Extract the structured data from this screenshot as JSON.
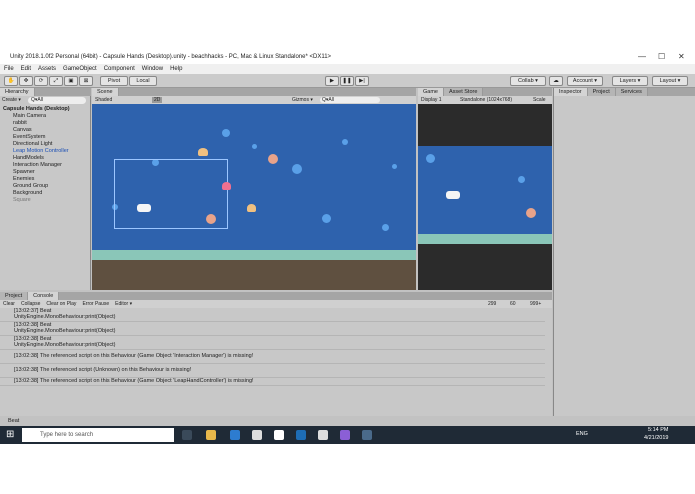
{
  "window": {
    "title": "Unity 2018.1.0f2 Personal (64bit) - Capsule Hands (Desktop).unity - beachhacks - PC, Mac & Linux Standalone* <DX11>"
  },
  "menu": [
    "File",
    "Edit",
    "Assets",
    "GameObject",
    "Component",
    "Window",
    "Help"
  ],
  "toolbar": {
    "pivot": "Pivot",
    "local": "Local",
    "collab": "Collab ▾",
    "account": "Account ▾",
    "layers": "Layers ▾",
    "layout": "Layout ▾"
  },
  "hierarchy": {
    "tab": "Hierarchy",
    "create": "Create ▾",
    "search": "Q▾All",
    "root": "Capsule Hands (Desktop)",
    "items": [
      "Main Camera",
      "rabbit",
      "Canvas",
      "EventSystem",
      "Directional Light",
      "Leap Motion Controller",
      "HandModels",
      "Interaction Manager",
      "Spawner",
      "Enemies",
      "Ground Group",
      "Background",
      "Square"
    ]
  },
  "scene": {
    "tab": "Scene",
    "shading": "Shaded",
    "mode": "2D",
    "gizmos": "Gizmos ▾",
    "search": "Q▾All"
  },
  "game": {
    "tab": "Game",
    "asset_store": "Asset Store",
    "display": "Display 1",
    "resolution": "Standalone (1024x768)",
    "scale": "Scale"
  },
  "inspector": {
    "tabs": [
      "Inspector",
      "Project",
      "Services"
    ]
  },
  "console": {
    "tabs": [
      "Project",
      "Console"
    ],
    "buttons": [
      "Clear",
      "Collapse",
      "Clear on Play",
      "Error Pause",
      "Editor ▾"
    ],
    "counts": {
      "info": "299",
      "warn": "60",
      "error": "999+"
    },
    "rows": [
      {
        "line1": "[13:02:37] Beat",
        "line2": "UnityEngine.MonoBehaviour:print(Object)"
      },
      {
        "line1": "[13:02:38] Beat",
        "line2": "UnityEngine.MonoBehaviour:print(Object)"
      },
      {
        "line1": "[13:02:38] Beat",
        "line2": "UnityEngine.MonoBehaviour:print(Object)"
      },
      {
        "line1": "[13:02:38] The referenced script on this Behaviour (Game Object 'Interaction Manager') is missing!",
        "line2": ""
      },
      {
        "line1": "[13:02:38] The referenced script (Unknown) on this Behaviour is missing!",
        "line2": ""
      },
      {
        "line1": "[13:02:38] The referenced script on this Behaviour (Game Object 'LeapHandController') is missing!",
        "line2": ""
      }
    ]
  },
  "status": {
    "text": "Beat"
  },
  "taskbar": {
    "search": "Type here to search",
    "lang": "ENG",
    "time": "5:14 PM",
    "date": "4/21/2019"
  },
  "colors": {
    "sky": "#2e62ad",
    "ground": "#5f5040",
    "sand": "#8ac6b8",
    "selection": "#3d7bd9",
    "taskbar": "#1f2a36"
  }
}
